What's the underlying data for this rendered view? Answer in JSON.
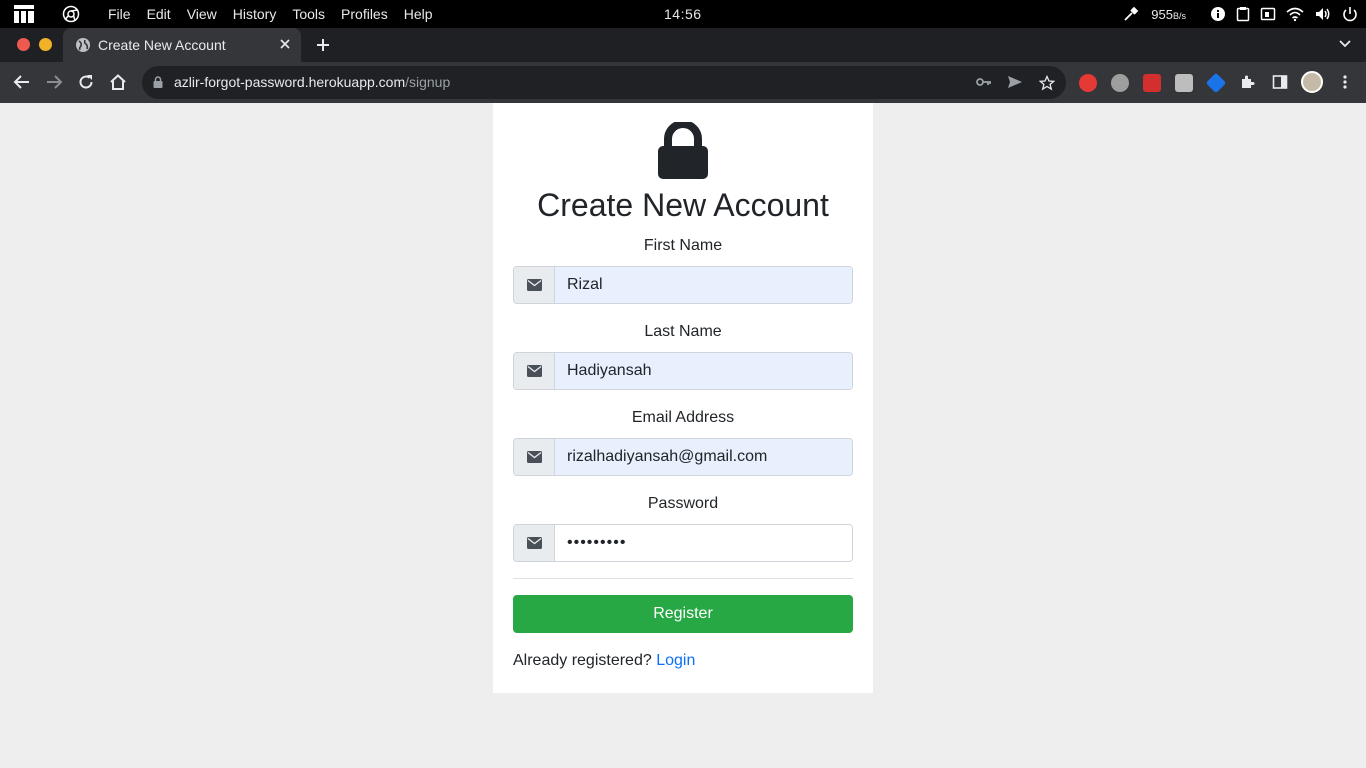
{
  "os": {
    "menus": [
      "File",
      "Edit",
      "View",
      "History",
      "Tools",
      "Profiles",
      "Help"
    ],
    "clock": "14:56",
    "net_speed": "955",
    "net_unit": "B/s"
  },
  "browser": {
    "tab_title": "Create New Account",
    "url_host": "azlir-forgot-password.herokuapp.com",
    "url_path": "/signup",
    "colors": {
      "tabstrip": "#1f2023",
      "toolbar": "#35363a",
      "omnibox": "#202124"
    }
  },
  "page": {
    "heading": "Create New Account",
    "fields": [
      {
        "label": "First Name",
        "value": "Rizal",
        "icon": "envelope-icon"
      },
      {
        "label": "Last Name",
        "value": "Hadiyansah",
        "icon": "envelope-icon"
      },
      {
        "label": "Email Address",
        "value": "rizalhadiyansah@gmail.com",
        "icon": "envelope-icon"
      },
      {
        "label": "Password",
        "value": "•••••••••",
        "icon": "envelope-icon"
      }
    ],
    "register_label": "Register",
    "already_text": "Already registered?",
    "login_link": "Login",
    "colors": {
      "register": "#28a745",
      "link": "#0d6efd",
      "autofill": "#e8f0fe",
      "page_bg": "#eeeeee"
    }
  }
}
